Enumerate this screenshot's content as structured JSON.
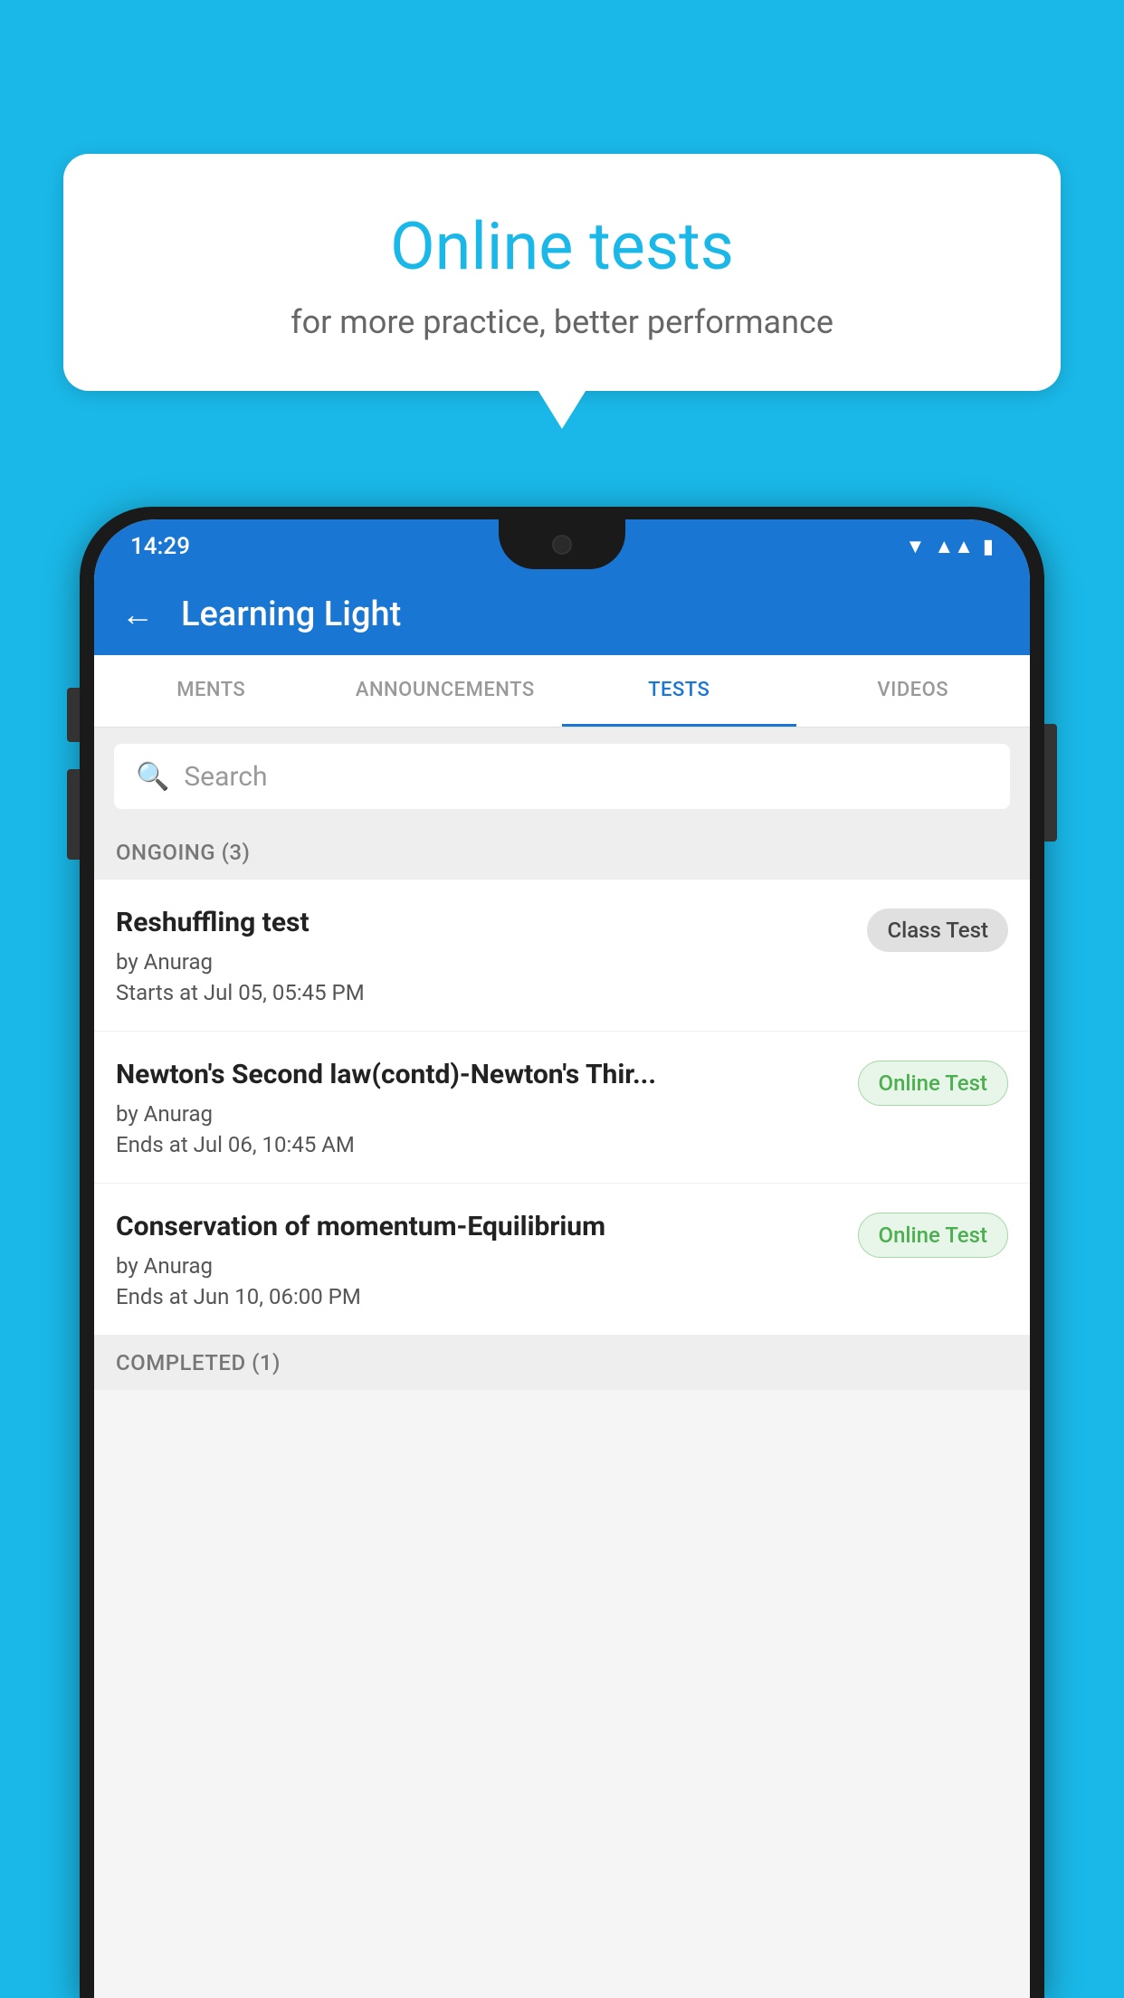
{
  "background_color": "#1ab8e8",
  "bubble": {
    "title": "Online tests",
    "subtitle": "for more practice, better performance"
  },
  "phone": {
    "status_bar": {
      "time": "14:29",
      "icons": [
        "wifi",
        "signal",
        "battery"
      ]
    },
    "app_bar": {
      "title": "Learning Light",
      "back_label": "←"
    },
    "tabs": [
      {
        "label": "MENTS",
        "active": false
      },
      {
        "label": "ANNOUNCEMENTS",
        "active": false
      },
      {
        "label": "TESTS",
        "active": true
      },
      {
        "label": "VIDEOS",
        "active": false
      }
    ],
    "search": {
      "placeholder": "Search"
    },
    "ongoing_section": {
      "label": "ONGOING (3)"
    },
    "tests": [
      {
        "name": "Reshuffling test",
        "author": "by Anurag",
        "date": "Starts at  Jul 05, 05:45 PM",
        "badge": "Class Test",
        "badge_type": "class"
      },
      {
        "name": "Newton's Second law(contd)-Newton's Thir...",
        "author": "by Anurag",
        "date": "Ends at  Jul 06, 10:45 AM",
        "badge": "Online Test",
        "badge_type": "online"
      },
      {
        "name": "Conservation of momentum-Equilibrium",
        "author": "by Anurag",
        "date": "Ends at  Jun 10, 06:00 PM",
        "badge": "Online Test",
        "badge_type": "online"
      }
    ],
    "completed_section": {
      "label": "COMPLETED (1)"
    }
  }
}
